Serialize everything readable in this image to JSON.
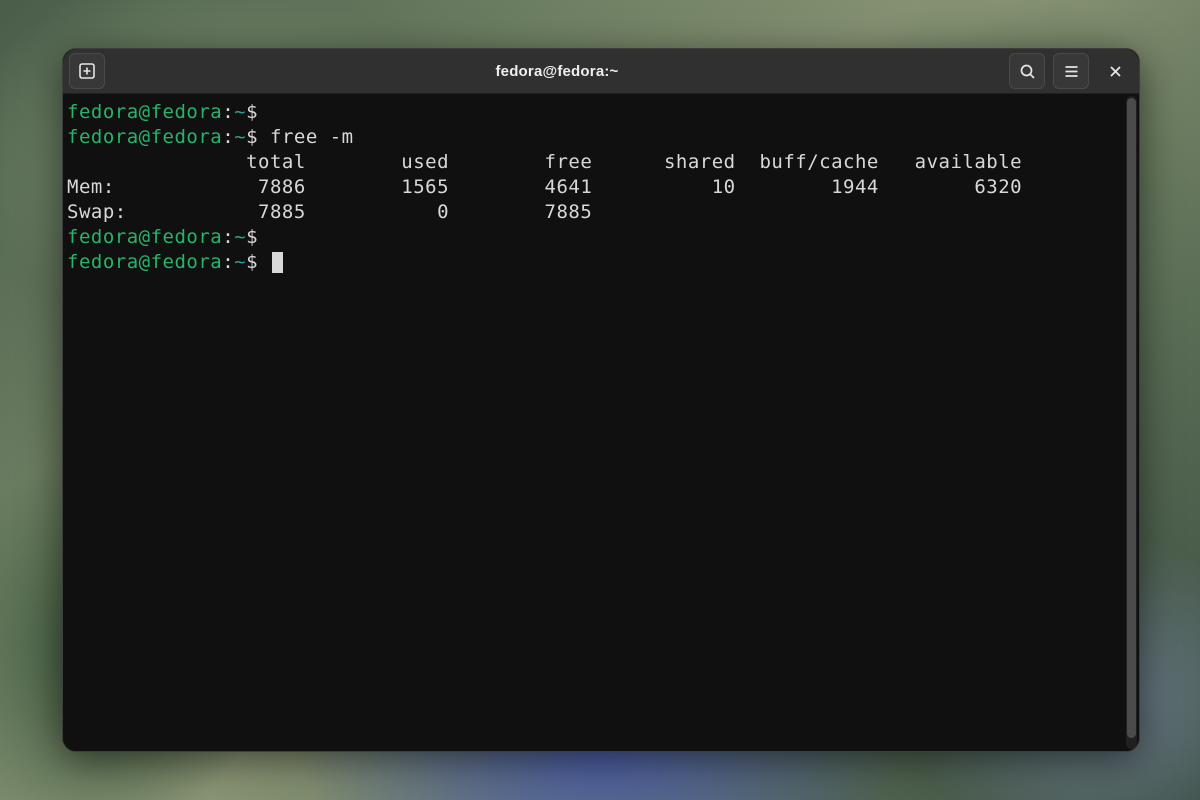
{
  "window": {
    "title": "fedora@fedora:~"
  },
  "prompt": {
    "user_host": "fedora@fedora",
    "sep": ":",
    "path": "~",
    "sigil": "$"
  },
  "lines": {
    "l1_cmd": "",
    "l2_cmd": "free -m",
    "header": "               total        used        free      shared  buff/cache   available",
    "mem": "Mem:            7886        1565        4641          10        1944        6320",
    "swap": "Swap:           7885           0        7885",
    "l5_cmd": "",
    "l6_cmd": ""
  }
}
